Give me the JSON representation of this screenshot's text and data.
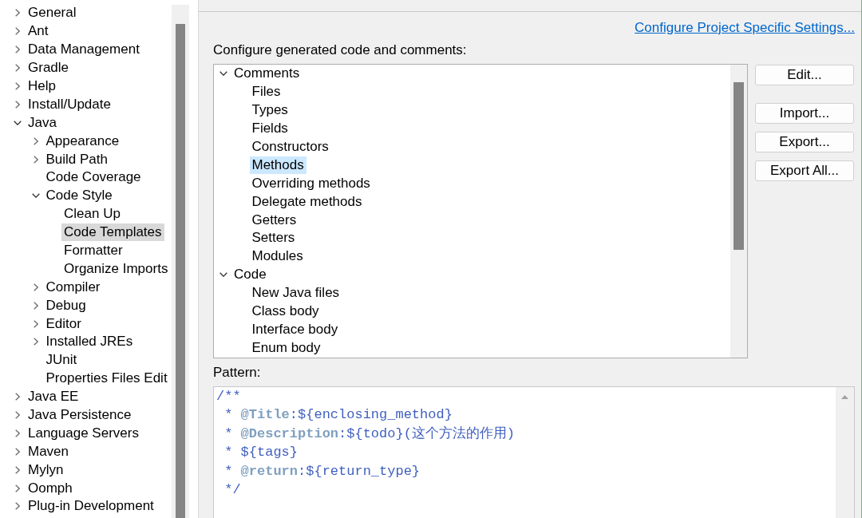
{
  "preferences_tree": {
    "items": [
      {
        "label": "General",
        "kind": "branch",
        "expanded": false,
        "selected": false
      },
      {
        "label": "Ant",
        "kind": "branch",
        "expanded": false,
        "selected": false
      },
      {
        "label": "Data Management",
        "kind": "branch",
        "expanded": false,
        "selected": false
      },
      {
        "label": "Gradle",
        "kind": "branch",
        "expanded": false,
        "selected": false
      },
      {
        "label": "Help",
        "kind": "branch",
        "expanded": false,
        "selected": false
      },
      {
        "label": "Install/Update",
        "kind": "branch",
        "expanded": false,
        "selected": false
      },
      {
        "label": "Java",
        "kind": "branch",
        "expanded": true,
        "selected": false,
        "children": [
          {
            "label": "Appearance",
            "kind": "branch",
            "expanded": false,
            "selected": false
          },
          {
            "label": "Build Path",
            "kind": "branch",
            "expanded": false,
            "selected": false
          },
          {
            "label": "Code Coverage",
            "kind": "leaf",
            "selected": false
          },
          {
            "label": "Code Style",
            "kind": "branch",
            "expanded": true,
            "selected": false,
            "children": [
              {
                "label": "Clean Up",
                "kind": "leaf",
                "selected": false
              },
              {
                "label": "Code Templates",
                "kind": "leaf",
                "selected": true
              },
              {
                "label": "Formatter",
                "kind": "leaf",
                "selected": false
              },
              {
                "label": "Organize Imports",
                "kind": "leaf",
                "selected": false
              }
            ]
          },
          {
            "label": "Compiler",
            "kind": "branch",
            "expanded": false,
            "selected": false
          },
          {
            "label": "Debug",
            "kind": "branch",
            "expanded": false,
            "selected": false
          },
          {
            "label": "Editor",
            "kind": "branch",
            "expanded": false,
            "selected": false
          },
          {
            "label": "Installed JREs",
            "kind": "branch",
            "expanded": false,
            "selected": false
          },
          {
            "label": "JUnit",
            "kind": "leaf",
            "selected": false
          },
          {
            "label": "Properties Files Edit",
            "kind": "leaf",
            "selected": false
          }
        ]
      },
      {
        "label": "Java EE",
        "kind": "branch",
        "expanded": false,
        "selected": false
      },
      {
        "label": "Java Persistence",
        "kind": "branch",
        "expanded": false,
        "selected": false
      },
      {
        "label": "Language Servers",
        "kind": "branch",
        "expanded": false,
        "selected": false
      },
      {
        "label": "Maven",
        "kind": "branch",
        "expanded": false,
        "selected": false
      },
      {
        "label": "Mylyn",
        "kind": "branch",
        "expanded": false,
        "selected": false
      },
      {
        "label": "Oomph",
        "kind": "branch",
        "expanded": false,
        "selected": false
      },
      {
        "label": "Plug-in Development",
        "kind": "branch",
        "expanded": false,
        "selected": false
      }
    ]
  },
  "project_settings_link": "Configure Project Specific Settings...",
  "templates_label": "Configure generated code and comments:",
  "templates_tree": {
    "items": [
      {
        "label": "Comments",
        "kind": "branch",
        "expanded": true,
        "selected": false,
        "children": [
          {
            "label": "Files",
            "kind": "leaf",
            "selected": false
          },
          {
            "label": "Types",
            "kind": "leaf",
            "selected": false
          },
          {
            "label": "Fields",
            "kind": "leaf",
            "selected": false
          },
          {
            "label": "Constructors",
            "kind": "leaf",
            "selected": false
          },
          {
            "label": "Methods",
            "kind": "leaf",
            "selected": true
          },
          {
            "label": "Overriding methods",
            "kind": "leaf",
            "selected": false
          },
          {
            "label": "Delegate methods",
            "kind": "leaf",
            "selected": false
          },
          {
            "label": "Getters",
            "kind": "leaf",
            "selected": false
          },
          {
            "label": "Setters",
            "kind": "leaf",
            "selected": false
          },
          {
            "label": "Modules",
            "kind": "leaf",
            "selected": false
          }
        ]
      },
      {
        "label": "Code",
        "kind": "branch",
        "expanded": true,
        "selected": false,
        "children": [
          {
            "label": "New Java files",
            "kind": "leaf",
            "selected": false
          },
          {
            "label": "Class body",
            "kind": "leaf",
            "selected": false
          },
          {
            "label": "Interface body",
            "kind": "leaf",
            "selected": false
          },
          {
            "label": "Enum body",
            "kind": "leaf",
            "selected": false
          }
        ]
      }
    ]
  },
  "buttons": [
    "Edit...",
    "Import...",
    "Export...",
    "Export All..."
  ],
  "pattern": {
    "label": "Pattern:",
    "lines": [
      "/**",
      " * **@Title**:${enclosing_method}",
      " * **@Description**:${todo}(这个方法的作用)",
      " * ${tags}",
      " * **@return**:${return_type}",
      " */"
    ]
  }
}
